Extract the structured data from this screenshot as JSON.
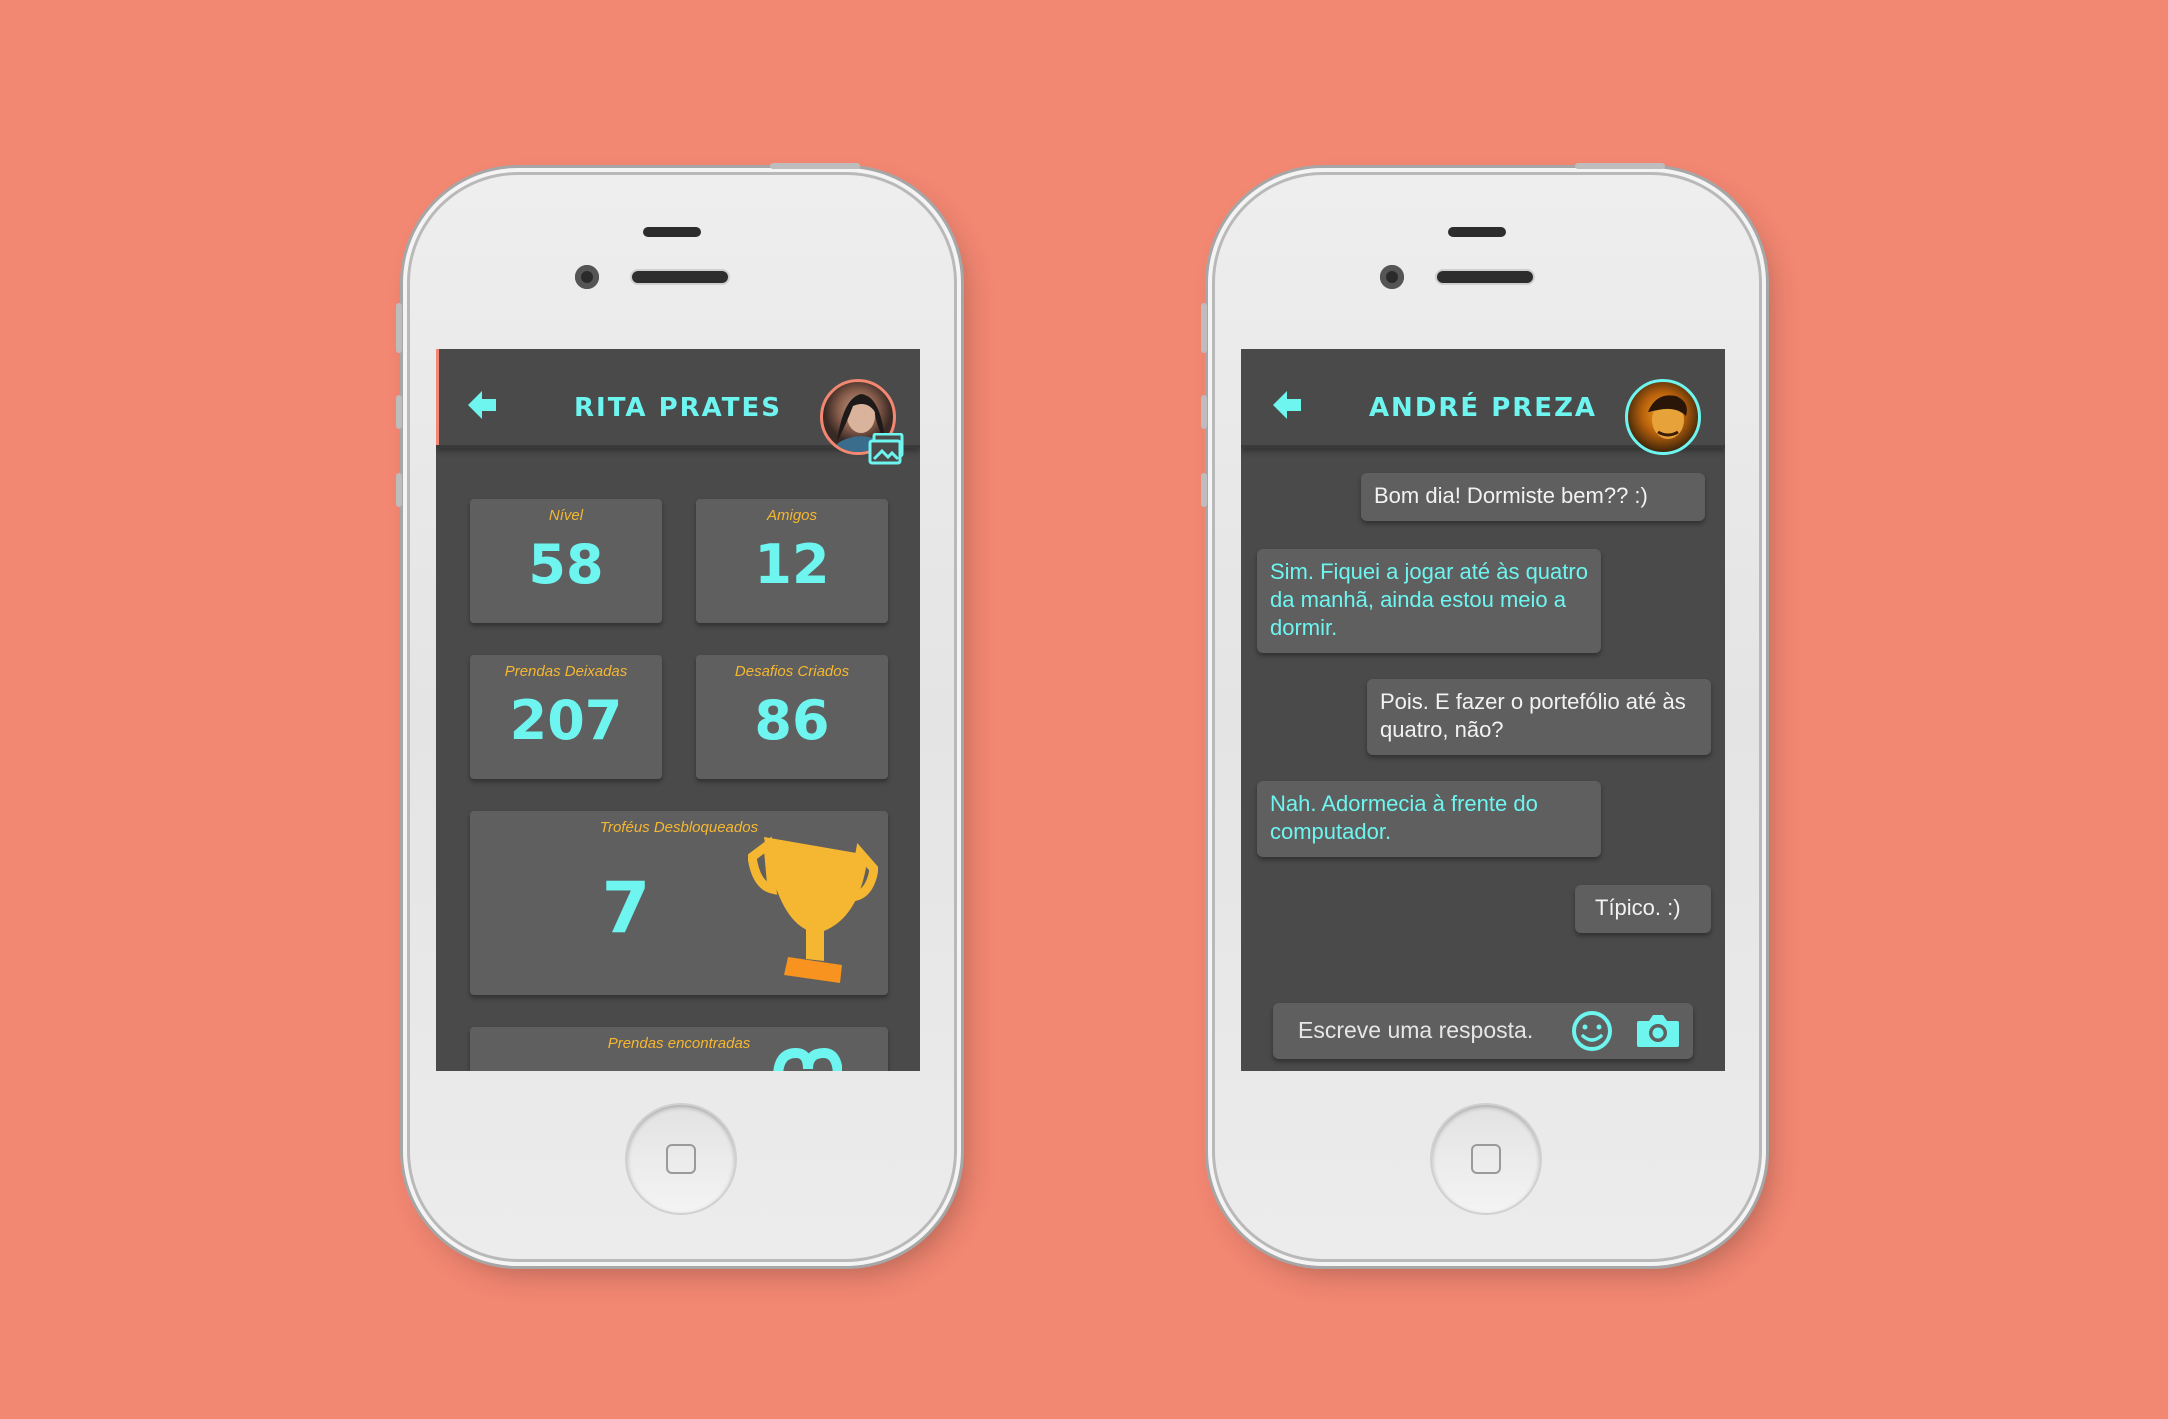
{
  "colors": {
    "background": "#f28772",
    "screen": "#4a4a4a",
    "card": "#5f5f5f",
    "cyan": "#6ef5f0",
    "gold": "#f5b731",
    "orange": "#f7931e"
  },
  "profile": {
    "title": "RITA PRATES",
    "stats": [
      {
        "label": "Nível",
        "value": "58"
      },
      {
        "label": "Amigos",
        "value": "12"
      },
      {
        "label": "Prendas Deixadas",
        "value": "207"
      },
      {
        "label": "Desafios Criados",
        "value": "86"
      }
    ],
    "trophies": {
      "label": "Troféus Desbloqueados",
      "value": "7",
      "icon": "trophy-icon"
    },
    "found": {
      "label": "Prendas encontradas"
    }
  },
  "chat": {
    "title": "ANDRÉ PREZA",
    "messages": [
      {
        "from": "me",
        "text": "Bom dia! Dormiste bem?? :)"
      },
      {
        "from": "them",
        "text": "Sim. Fiquei a jogar até às quatro da manhã, ainda estou meio a dormir."
      },
      {
        "from": "me",
        "text": "Pois. E fazer o portefólio até às quatro, não?"
      },
      {
        "from": "them",
        "text": "Nah. Adormecia à frente do computador."
      },
      {
        "from": "me",
        "text": "Típico.  :)"
      }
    ],
    "input_placeholder": "Escreve uma resposta.",
    "icons": [
      "smiley-icon",
      "camera-icon"
    ]
  }
}
